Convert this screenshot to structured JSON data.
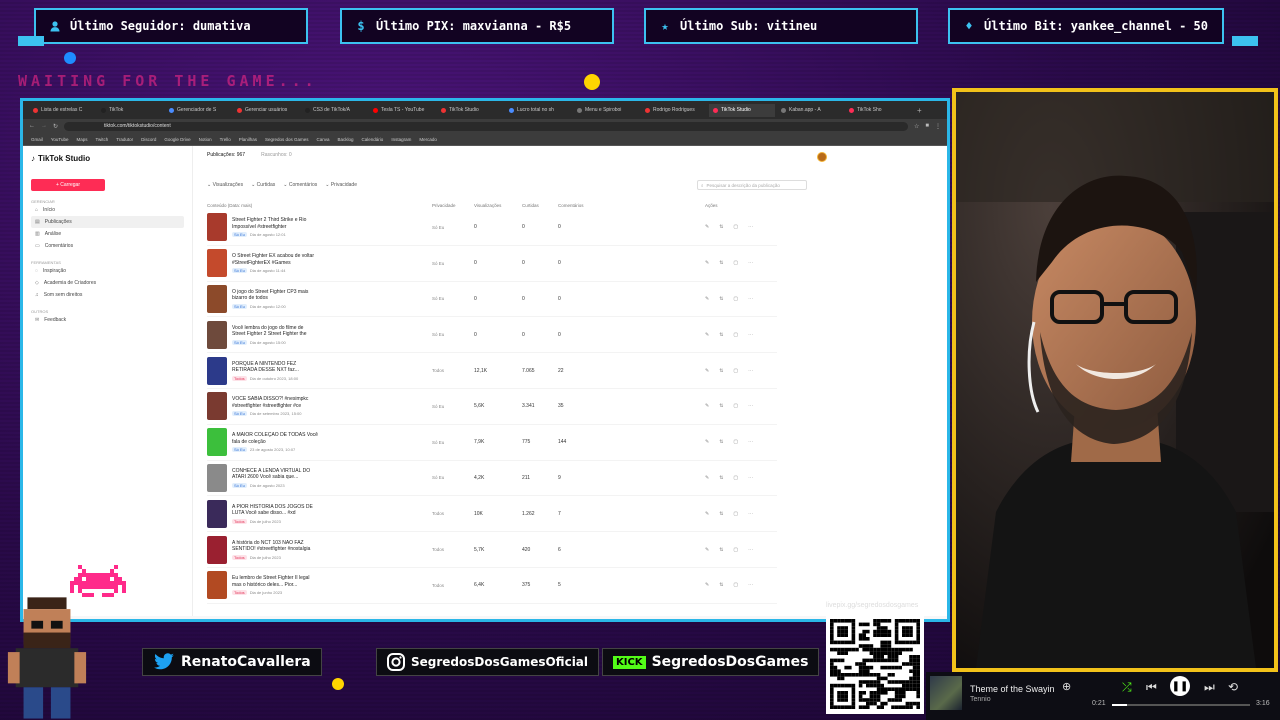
{
  "alerts": {
    "follower": "Último Seguidor: dumativa",
    "pix": "Último PIX: maxvianna - R$5",
    "sub": "Último Sub: vitineu",
    "bit": "Último Bit: yankee_channel - 50"
  },
  "waiting_text": "WAITING FOR THE GAME...",
  "browser": {
    "tabs": [
      "Lista de estrelas C",
      "TikTok",
      "Gerenciador de S",
      "Gerenciar usuários",
      "CS3 de TikTok/A",
      "Tesla TS - YouTube",
      "TikTok Studio",
      "Lucro total no sh",
      "Menu e Spiroboi",
      "Rodrigo Rodrigues",
      "TikTok Studio",
      "Kaban.app - A",
      "TikTok Sho"
    ],
    "url": "tiktok.com/tiktokstudio/content",
    "bookmarks": [
      "Gmail",
      "YouTube",
      "Maps",
      "Twitch",
      "Tradutor",
      "Discord",
      "Google Drive",
      "Notion",
      "Trello",
      "Planilhas",
      "Segredos dos Games",
      "Canva",
      "Backlog",
      "Calendário",
      "Instagram",
      "Mercado"
    ]
  },
  "studio": {
    "logo": "TikTok Studio",
    "upload_label": "+ Carregar",
    "section_manage": "GERENCIAR",
    "section_tools": "FERRAMENTAS",
    "section_other": "OUTROS",
    "nav": [
      "Início",
      "Publicações",
      "Análise",
      "Comentários"
    ],
    "tools": [
      "Inspiração",
      "Academia de Criadores",
      "Som sem direitos"
    ],
    "other": [
      "Feedback"
    ],
    "tabs": [
      "Publicações: 967",
      "Rascunhos: 0"
    ],
    "filters": [
      "Visualizações",
      "Curtidas",
      "Comentários",
      "Privacidade"
    ],
    "search_placeholder": "Pesquisar a descrição da publicação",
    "columns": [
      "Conteúdo (Data: mais)",
      "Privacidade",
      "Visualizações",
      "Curtidas",
      "Comentários",
      "Ações"
    ],
    "rows": [
      {
        "title": "Street Fighter 2 Third Strike e Rio Impossível #streetfighter",
        "meta": "Dia de agosto 12:01",
        "privacy": "Só Eu",
        "views": "0",
        "likes": "0",
        "comments": "0",
        "thumb": "#a83a2c"
      },
      {
        "title": "O Street Fighter EX acabou de voltar #StreetFighterEX #Games",
        "meta": "Dia de agosto 11:44",
        "privacy": "Só Eu",
        "views": "0",
        "likes": "0",
        "comments": "0",
        "thumb": "#c44a2c"
      },
      {
        "title": "O jogo do Street Fighter CP3 mais bizarro de todos",
        "meta": "Dia de agosto 12:00",
        "privacy": "Só Eu",
        "views": "0",
        "likes": "0",
        "comments": "0",
        "thumb": "#8c4a2a"
      },
      {
        "title": "Você lembra do jogo do filme de Street Fighter 2 Street Fighter the",
        "meta": "Dia de agosto 15:00",
        "privacy": "Só Eu",
        "views": "0",
        "likes": "0",
        "comments": "0",
        "thumb": "#6e4a3c"
      },
      {
        "title": "PORQUE A NINTENDO FEZ RETIRADA DESSE NXT faz...",
        "meta": "Dia de outubro 2023, 18:00",
        "privacy": "Todos",
        "views": "12,1K",
        "likes": "7.065",
        "comments": "22",
        "thumb": "#2c3a8a"
      },
      {
        "title": "VOCÊ SABIA DISSO?! #nesimpkc #streetfighter #streetfighter #ce",
        "meta": "Dia de setembro 2023, 15:00",
        "privacy": "Só Eu",
        "views": "5,6K",
        "likes": "3.341",
        "comments": "35",
        "thumb": "#7a3a30"
      },
      {
        "title": "A MAIOR COLEÇÃO DE TODAS Você fala de coleção",
        "meta": "23 de agosto 2023, 10:07",
        "privacy": "Só Eu",
        "views": "7,9K",
        "likes": "775",
        "comments": "144",
        "thumb": "#3cbf3c"
      },
      {
        "title": "CONHECE A LENDA VIRTUAL DO ATARI 2600 Você sabia que...",
        "meta": "Dia de agosto 2023",
        "privacy": "Só Eu",
        "views": "4,2K",
        "likes": "211",
        "comments": "9",
        "thumb": "#8a8a8a"
      },
      {
        "title": "A PIOR HISTÓRIA DOS JOGOS DE LUTA Você sabe disso... #xd",
        "meta": "Dia de julho 2023",
        "privacy": "Todos",
        "views": "10K",
        "likes": "1.262",
        "comments": "7",
        "thumb": "#3a2a5a"
      },
      {
        "title": "A história do NCT 103 NÃO FAZ SENTIDO! #streetfighter #nostalgia",
        "meta": "Dia de julho 2023",
        "privacy": "Todos",
        "views": "5,7K",
        "likes": "420",
        "comments": "6",
        "thumb": "#9a2030"
      },
      {
        "title": "Eu lembro de Street Fighter II legal mas o histórico deles... Pior...",
        "meta": "Dia de junho 2023",
        "privacy": "Todos",
        "views": "6,4K",
        "likes": "375",
        "comments": "5",
        "thumb": "#b24a22"
      }
    ]
  },
  "socials": {
    "twitter": "RenatoCavallera",
    "instagram": "SegredosDosGamesOficial",
    "kick_badge": "KICK",
    "kick": "SegredosDosGames",
    "qr_link": "livepix.gg/segredosdosgames"
  },
  "player": {
    "title": "Theme of the Swaying",
    "artist": "Tennio",
    "elapsed": "0:21",
    "duration": "3:16",
    "progress": 0.107
  },
  "colors": {
    "frame": "#2bb7e8",
    "cam_border": "#f2c21a",
    "accent_pink": "#ff2a8a",
    "tiktok_red": "#fe2c55"
  }
}
